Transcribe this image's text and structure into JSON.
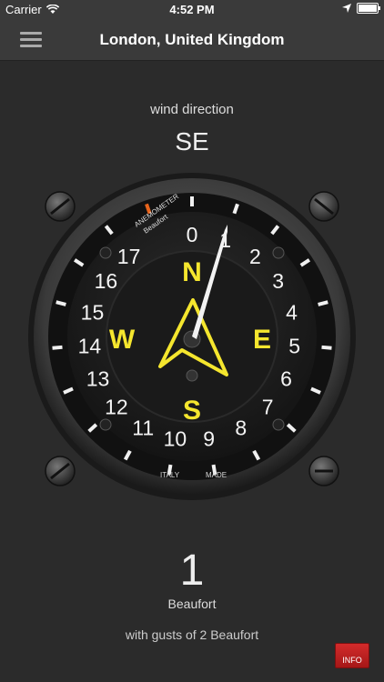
{
  "status_bar": {
    "carrier": "Carrier",
    "time": "4:52 PM"
  },
  "nav": {
    "title": "London, United Kingdom"
  },
  "wind": {
    "label": "wind direction",
    "value": "SE"
  },
  "gauge": {
    "brand_line1": "ANEMOMETER",
    "brand_line2": "Beaufort",
    "made_label1": "ITALY",
    "made_label2": "MADE",
    "scale": [
      "0",
      "1",
      "2",
      "3",
      "4",
      "5",
      "6",
      "7",
      "8",
      "9",
      "10",
      "11",
      "12",
      "13",
      "14",
      "15",
      "16",
      "17"
    ],
    "compass": {
      "n": "N",
      "e": "E",
      "s": "S",
      "w": "W"
    },
    "needle_value": 1,
    "accent_color": "#f5e62e",
    "warning_color": "#e8641c"
  },
  "speed": {
    "value": "1",
    "unit": "Beaufort",
    "gusts": "with gusts of 2 Beaufort"
  },
  "info_button": {
    "label": "INFO"
  },
  "colors": {
    "background": "#2b2b2b",
    "bar": "#3a3a3a",
    "info": "#c62222"
  }
}
